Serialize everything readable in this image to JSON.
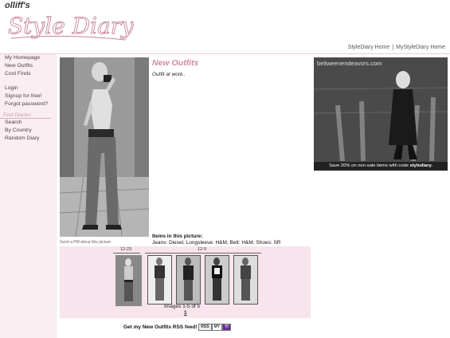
{
  "header": {
    "owner": "olliff's",
    "logo_text": "Style Diary"
  },
  "topnav": {
    "link1": "StyleDiary Home",
    "separator": "|",
    "link2": "MyStyleDiary Home"
  },
  "sidebar": {
    "items_a": [
      "My Homepage",
      "New Outfits",
      "Cool Finds"
    ],
    "items_b": [
      "Login",
      "Signup for free!",
      "Forgot password?"
    ],
    "find_heading": "Find Diaries",
    "items_c": [
      "Search",
      "By Country",
      "Random Diary"
    ]
  },
  "main": {
    "title": "New Outfits",
    "caption": "Outfit at work..",
    "send_pm": "Send a PM about this picture",
    "items_heading": "Items in this picture:",
    "items_text": "Jeans: Diesel, Longsleeve: H&M, Belt: H&M, Shoes: SR"
  },
  "ad": {
    "url": "beltweenendeavors.com",
    "bar_prefix": "Save 20% on non-sale items with code ",
    "code": "stylediary."
  },
  "gallery": {
    "date1": "12-23",
    "date2": "12-9",
    "images_count": "Images 1-5 of 5",
    "page": "1"
  },
  "rss": {
    "text": "Get my New Outfits RSS feed!",
    "badge_rss": "RSS",
    "badge_my": "MY",
    "badge_yahoo": "Y!"
  }
}
